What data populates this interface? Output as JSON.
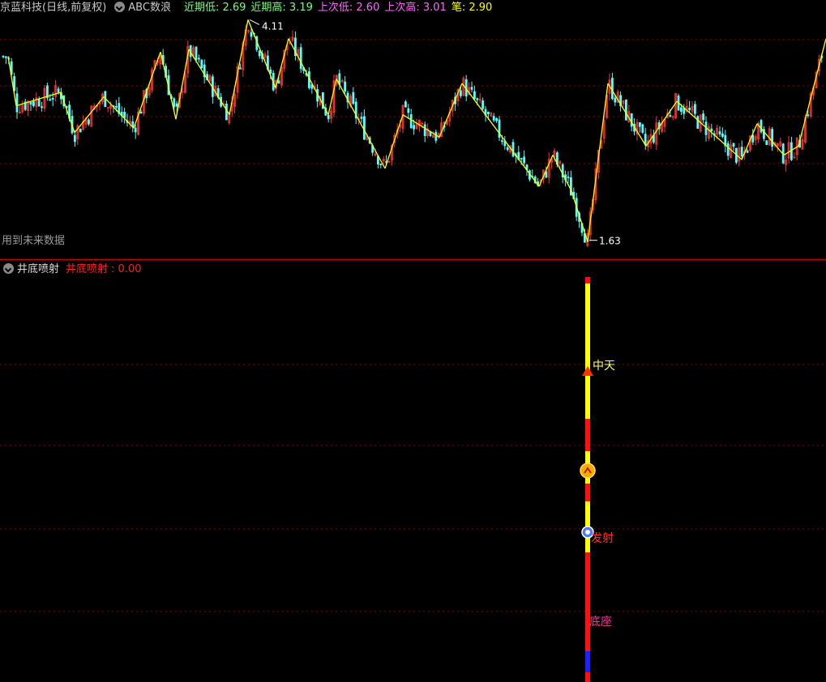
{
  "top_panel": {
    "stock_title": "京蓝科技(日线,前复权)",
    "indicator_name": "ABC数浪",
    "stats": [
      {
        "label": "近期低",
        "value": "2.69",
        "color": "#7cfc7c"
      },
      {
        "label": "近期高",
        "value": "3.19",
        "color": "#7cfc7c"
      },
      {
        "label": "上次低",
        "value": "2.60",
        "color": "#ff66ff"
      },
      {
        "label": "上次高",
        "value": "3.01",
        "color": "#ff66ff"
      },
      {
        "label": "笔",
        "value": "2.90",
        "color": "#ffff00"
      }
    ],
    "high_label": "4.11",
    "low_label": "1.63",
    "future_data_note": "用到未来数据"
  },
  "bottom_panel": {
    "indicator_name": "井底喷射",
    "value_label": "井底喷射",
    "value": "0.00",
    "markers": {
      "zhongtian": "中天",
      "fashe": "发射",
      "dizuo": "底座"
    }
  },
  "colors": {
    "background": "#000000",
    "up": "#ff3333",
    "down": "#54ffff",
    "zigzag": "#ffff00",
    "grid": "#8b0000",
    "divider": "#cc0000"
  },
  "chart_data": {
    "type": "line",
    "title": "ABC数浪",
    "series": [
      {
        "name": "笔",
        "values": [
          3.7,
          3.15,
          3.3,
          2.85,
          3.25,
          2.9,
          3.75,
          3.0,
          3.78,
          3.05,
          4.11,
          3.35,
          3.9,
          3.05,
          3.45,
          2.45,
          3.05,
          2.8,
          3.4,
          2.25,
          2.6,
          2.2,
          1.63,
          3.4,
          2.7,
          3.2,
          2.55,
          2.95,
          2.6,
          2.7,
          3.9
        ]
      }
    ],
    "annotations": [
      "4.11",
      "1.63"
    ]
  }
}
